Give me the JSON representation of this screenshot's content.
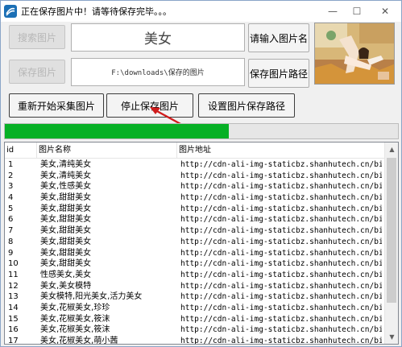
{
  "window": {
    "title": "正在保存图片中！请等待保存完毕。。。"
  },
  "row1": {
    "search_button": "搜索图片",
    "keyword": "美女",
    "input_name_button": "请输入图片名"
  },
  "row2": {
    "save_button": "保存图片",
    "path": "F:\\downloads\\保存的图片",
    "save_path_button": "保存图片路径"
  },
  "row3": {
    "restart_button": "重新开始采集图片",
    "stop_button": "停止保存图片",
    "set_path_button": "设置图片保存路径"
  },
  "progress": {
    "fraction": 0.57,
    "color": "#06b025"
  },
  "table": {
    "headers": [
      "id",
      "图片名称",
      "图片地址"
    ],
    "rows": [
      {
        "id": "1",
        "name": "美女,清纯美女",
        "url": "http://cdn-ali-img-staticbz.shanhutech.cn/biz..."
      },
      {
        "id": "2",
        "name": "美女,清纯美女",
        "url": "http://cdn-ali-img-staticbz.shanhutech.cn/biz..."
      },
      {
        "id": "3",
        "name": "美女,性感美女",
        "url": "http://cdn-ali-img-staticbz.shanhutech.cn/biz..."
      },
      {
        "id": "4",
        "name": "美女,甜甜美女",
        "url": "http://cdn-ali-img-staticbz.shanhutech.cn/biz..."
      },
      {
        "id": "5",
        "name": "美女,甜甜美女",
        "url": "http://cdn-ali-img-staticbz.shanhutech.cn/biz..."
      },
      {
        "id": "6",
        "name": "美女,甜甜美女",
        "url": "http://cdn-ali-img-staticbz.shanhutech.cn/biz..."
      },
      {
        "id": "7",
        "name": "美女,甜甜美女",
        "url": "http://cdn-ali-img-staticbz.shanhutech.cn/biz..."
      },
      {
        "id": "8",
        "name": "美女,甜甜美女",
        "url": "http://cdn-ali-img-staticbz.shanhutech.cn/biz..."
      },
      {
        "id": "9",
        "name": "美女,甜甜美女",
        "url": "http://cdn-ali-img-staticbz.shanhutech.cn/biz..."
      },
      {
        "id": "10",
        "name": "美女,甜甜美女",
        "url": "http://cdn-ali-img-staticbz.shanhutech.cn/biz..."
      },
      {
        "id": "11",
        "name": "性感美女,美女",
        "url": "http://cdn-ali-img-staticbz.shanhutech.cn/biz..."
      },
      {
        "id": "12",
        "name": "美女,美女模特",
        "url": "http://cdn-ali-img-staticbz.shanhutech.cn/biz..."
      },
      {
        "id": "13",
        "name": "美女模特,阳光美女,活力美女",
        "url": "http://cdn-ali-img-staticbz.shanhutech.cn/biz..."
      },
      {
        "id": "14",
        "name": "美女,花椒美女,珍珍",
        "url": "http://cdn-ali-img-staticbz.shanhutech.cn/biz..."
      },
      {
        "id": "15",
        "name": "美女,花椒美女,筱沫",
        "url": "http://cdn-ali-img-staticbz.shanhutech.cn/biz..."
      },
      {
        "id": "16",
        "name": "美女,花椒美女,筱沫",
        "url": "http://cdn-ali-img-staticbz.shanhutech.cn/biz..."
      },
      {
        "id": "17",
        "name": "美女,花椒美女,萌小茜",
        "url": "http://cdn-ali-img-staticbz.shanhutech.cn/biz..."
      },
      {
        "id": "18",
        "name": "美女,花椒美女,冰冰",
        "url": "http://cdn-ali-img-staticbz.shanhutech.cn/biz..."
      }
    ]
  }
}
